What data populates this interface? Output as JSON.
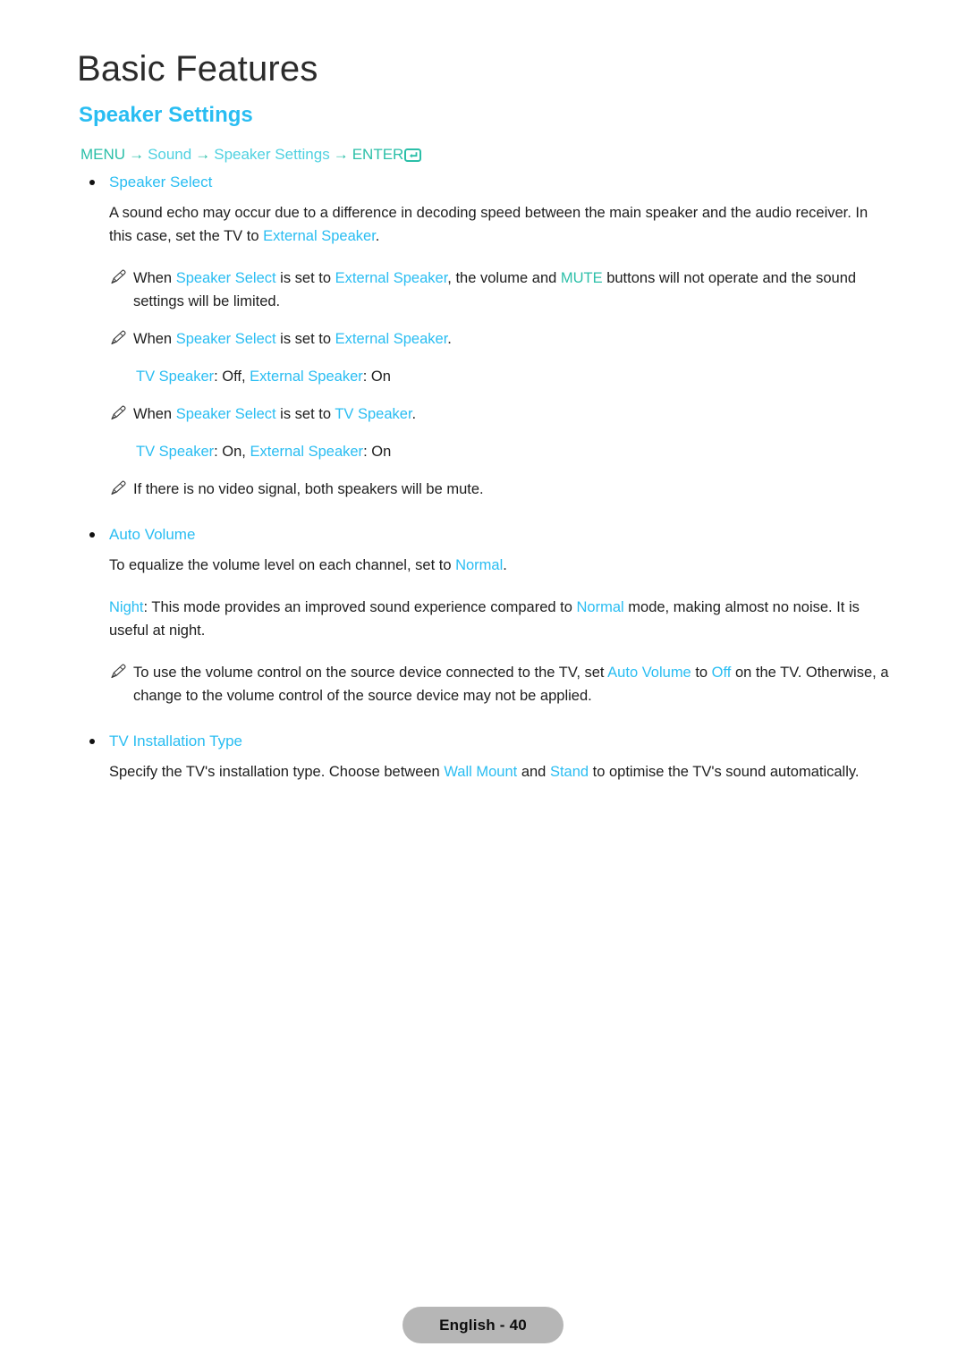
{
  "page": {
    "chapter_title": "Basic Features",
    "section_title": "Speaker Settings"
  },
  "breadcrumb": {
    "menu_label": "MENU",
    "arrow": "→",
    "item1": "Sound",
    "item2": "Speaker Settings",
    "enter_label": "ENTER",
    "enter_icon": "enter-return-icon"
  },
  "sections": [
    {
      "heading": "Speaker Select",
      "body": {
        "p1_a": "A sound echo may occur due to a difference in decoding speed between the main speaker and the audio receiver. In this case, set the TV to ",
        "p1_b": "External Speaker",
        "p1_c": ".",
        "n1_a": "When ",
        "n1_b": "Speaker Select",
        "n1_c": " is set to ",
        "n1_d": "External Speaker",
        "n1_e": ", the volume and ",
        "n1_f": "MUTE",
        "n1_g": " buttons will not operate and the sound settings will be limited.",
        "n2_a": "When ",
        "n2_b": "Speaker Select",
        "n2_c": " is set to ",
        "n2_d": "External Speaker",
        "n2_e": ".",
        "v1_a": "TV Speaker",
        "v1_b": ": Off, ",
        "v1_c": "External Speaker",
        "v1_d": ": On",
        "n3_a": "When ",
        "n3_b": "Speaker Select",
        "n3_c": " is set to ",
        "n3_d": "TV Speaker",
        "n3_e": ".",
        "v2_a": "TV Speaker",
        "v2_b": ": On, ",
        "v2_c": "External Speaker",
        "v2_d": ": On",
        "n4": "If there is no video signal, both speakers will be mute."
      }
    },
    {
      "heading": "Auto Volume",
      "body": {
        "p1_a": "To equalize the volume level on each channel, set to ",
        "p1_b": "Normal",
        "p1_c": ".",
        "p2_a": "Night",
        "p2_b": ": This mode provides an improved sound experience compared to ",
        "p2_c": "Normal",
        "p2_d": " mode, making almost no noise. It is useful at night.",
        "n1_a": "To use the volume control on the source device connected to the TV, set ",
        "n1_b": "Auto Volume",
        "n1_c": " to ",
        "n1_d": "Off",
        "n1_e": " on the TV. Otherwise, a change to the volume control of the source device may not be applied."
      }
    },
    {
      "heading": "TV Installation Type",
      "body": {
        "p1_a": "Specify the TV's installation type. Choose between ",
        "p1_b": "Wall Mount",
        "p1_c": " and ",
        "p1_d": "Stand",
        "p1_e": " to optimise the TV's sound automatically."
      }
    }
  ],
  "footer": {
    "page_label": "English - 40"
  },
  "colors": {
    "menu_blue": "#29bdf2",
    "hardware_teal": "#2bbfa8",
    "body_text": "#1d1d1d",
    "footer_pill": "#b6b6b6"
  }
}
